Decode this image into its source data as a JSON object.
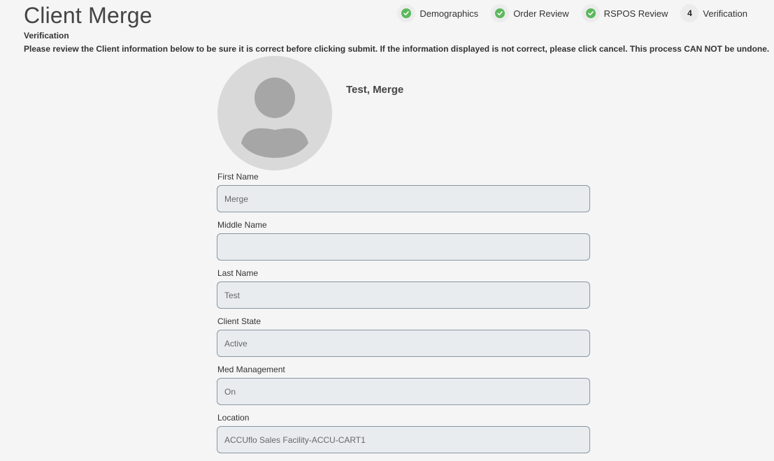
{
  "page": {
    "title": "Client Merge",
    "subtitle": "Verification",
    "instructions": "Please review the Client information below to be sure it is correct before clicking submit. If the information displayed is not correct, please click cancel. This process CAN NOT be undone."
  },
  "steps": [
    {
      "label": "Demographics",
      "status": "complete",
      "icon": "check-circle-icon"
    },
    {
      "label": "Order Review",
      "status": "complete",
      "icon": "check-circle-icon"
    },
    {
      "label": "RSPOS Review",
      "status": "complete",
      "icon": "check-circle-icon"
    },
    {
      "label": "Verification",
      "status": "current",
      "number": "4"
    }
  ],
  "client": {
    "display_name": "Test, Merge",
    "avatar_icon": "user-placeholder-icon"
  },
  "fields": {
    "first_name": {
      "label": "First Name",
      "value": "Merge"
    },
    "middle_name": {
      "label": "Middle Name",
      "value": ""
    },
    "last_name": {
      "label": "Last Name",
      "value": "Test"
    },
    "client_state": {
      "label": "Client State",
      "value": "Active"
    },
    "med_management": {
      "label": "Med Management",
      "value": "On"
    },
    "location": {
      "label": "Location",
      "value": "ACCUflo Sales Facility-ACCU-CART1"
    }
  },
  "colors": {
    "check_green": "#5cb85c",
    "background": "#f5f5f5",
    "input_bg": "#e9ecef",
    "input_border": "#8a96a3"
  }
}
